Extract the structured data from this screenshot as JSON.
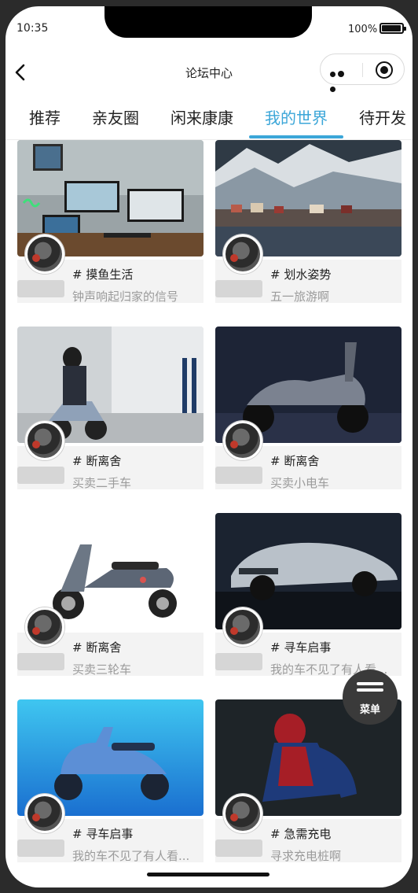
{
  "status_bar": {
    "time": "10:35",
    "battery": "100%"
  },
  "nav": {
    "title": "论坛中心"
  },
  "tabs": [
    {
      "label": "推荐",
      "active": false
    },
    {
      "label": "亲友圈",
      "active": false
    },
    {
      "label": "闲来康康",
      "active": false
    },
    {
      "label": "我的世界",
      "active": true
    },
    {
      "label": "待开发",
      "active": false
    }
  ],
  "cards": [
    {
      "tag": "# 摸鱼生活",
      "desc": "钟声响起归家的信号",
      "image": "desk-setup",
      "follow": ""
    },
    {
      "tag": "# 划水姿势",
      "desc": "五一旅游啊",
      "image": "snowy-village",
      "follow": ""
    },
    {
      "tag": "# 断离舍",
      "desc": "买卖二手车",
      "image": "scooter-riders",
      "follow": ""
    },
    {
      "tag": "# 断离舍",
      "desc": "买卖小电车",
      "image": "scooter-dark",
      "follow": ""
    },
    {
      "tag": "# 断离舍",
      "desc": "买卖三轮车",
      "image": "scooter-white",
      "follow": ""
    },
    {
      "tag": "# 寻车启事",
      "desc": "我的车不见了有人看...",
      "image": "bmw-car",
      "follow": ""
    },
    {
      "tag": "# 寻车启事",
      "desc": "我的车不见了有人看...",
      "image": "scooter-blue",
      "follow": ""
    },
    {
      "tag": "# 急需充电",
      "desc": "寻求充电桩啊",
      "image": "spiderman",
      "follow": ""
    }
  ],
  "fab": {
    "label": "菜单"
  },
  "colors": {
    "accent": "#3ba6d8",
    "fab_bg": "#3a3a3a",
    "info_bg": "#f3f3f3"
  }
}
